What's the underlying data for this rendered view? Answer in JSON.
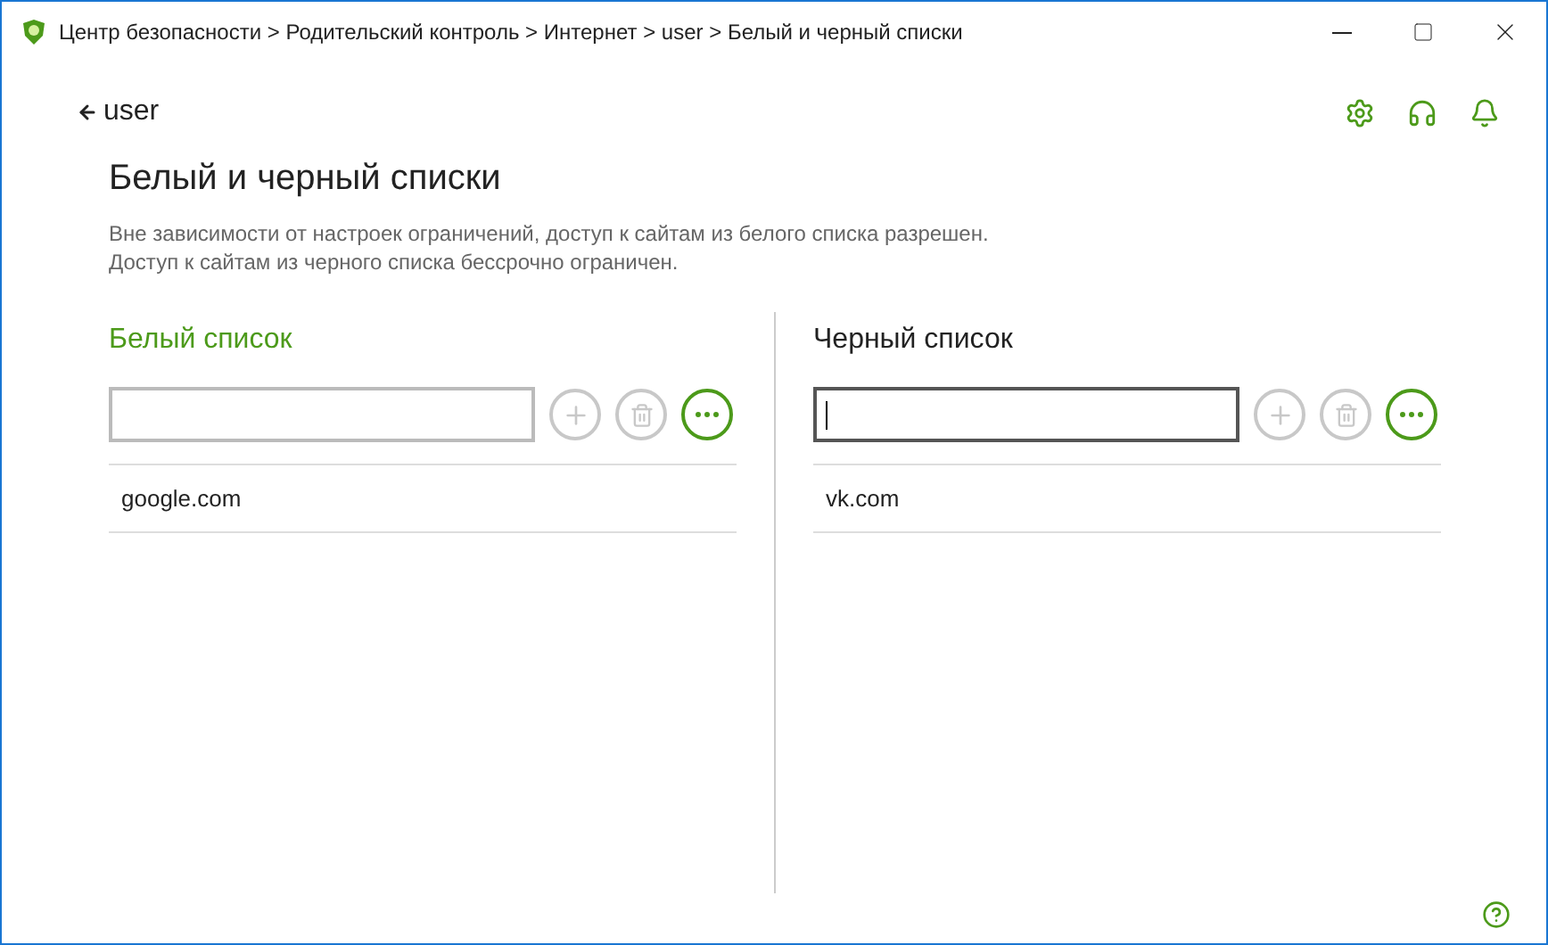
{
  "window": {
    "title": "Центр безопасности > Родительский контроль > Интернет > user > Белый и черный списки"
  },
  "back": {
    "label": "user"
  },
  "heading": "Белый и черный списки",
  "description": [
    "Вне зависимости от настроек ограничений, доступ к сайтам из белого списка разрешен.",
    "Доступ к сайтам из черного списка бессрочно ограничен."
  ],
  "lists": [
    {
      "title": "Белый список",
      "active": true,
      "field": {
        "focused": false
      },
      "items": [
        "google.com"
      ]
    },
    {
      "title": "Черный список",
      "active": false,
      "field": {
        "focused": true
      },
      "items": [
        "vk.com"
      ]
    }
  ]
}
